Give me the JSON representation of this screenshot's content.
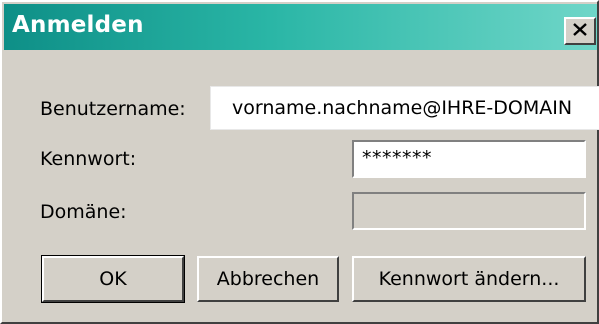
{
  "window": {
    "title": "Anmelden",
    "close_glyph": "✕"
  },
  "form": {
    "username_label": "Benutzername:",
    "username_value": "vorname.nachname@IHRE-DOMAIN",
    "password_label": "Kennwort:",
    "password_value": "*******",
    "domain_label": "Domäne:",
    "domain_value": ""
  },
  "buttons": {
    "ok": "OK",
    "cancel": "Abbrechen",
    "change_password": "Kennwort ändern..."
  },
  "colors": {
    "titlebar_start": "#0e8f87",
    "titlebar_end": "#6fd6c8",
    "dialog_face": "#d4d0c8"
  }
}
